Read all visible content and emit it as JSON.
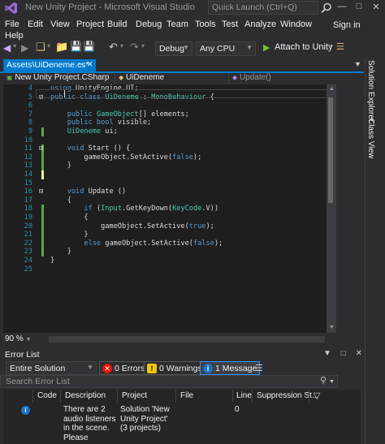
{
  "window": {
    "title": "New Unity Project - Microsoft Visual Studio",
    "quick_launch_placeholder": "Quick Launch (Ctrl+Q)",
    "sign_in": "Sign in"
  },
  "menu": [
    "File",
    "Edit",
    "View",
    "Project",
    "Build",
    "Debug",
    "Team",
    "Tools",
    "Test",
    "Analyze",
    "Window",
    "Help"
  ],
  "toolbar": {
    "configuration": "Debug",
    "platform": "Any CPU",
    "run_label": "Attach to Unity"
  },
  "tab": {
    "label": "Assets\\UiDeneme.cs*"
  },
  "navbar": {
    "project": "New Unity Project.CSharp",
    "class": "UiDeneme",
    "member": "Update()"
  },
  "editor": {
    "zoom": "90 %",
    "lines": [
      {
        "n": "4",
        "code": "using UnityEngine.UI;"
      },
      {
        "n": "5",
        "code": "public class UiDeneme : MonoBehaviour {"
      },
      {
        "n": "6",
        "code": ""
      },
      {
        "n": "7",
        "code": "    public GameObject[] elements;"
      },
      {
        "n": "8",
        "code": "    public bool visible;"
      },
      {
        "n": "9",
        "code": "    UiDeneme ui;"
      },
      {
        "n": "10",
        "code": ""
      },
      {
        "n": "11",
        "code": "    void Start () {"
      },
      {
        "n": "12",
        "code": "        gameObject.SetActive(false);"
      },
      {
        "n": "13",
        "code": "    }"
      },
      {
        "n": "14",
        "code": ""
      },
      {
        "n": "15",
        "code": ""
      },
      {
        "n": "16",
        "code": "    void Update ()"
      },
      {
        "n": "17",
        "code": "    {"
      },
      {
        "n": "18",
        "code": "        if (Input.GetKeyDown(KeyCode.V))"
      },
      {
        "n": "19",
        "code": "        {"
      },
      {
        "n": "20",
        "code": "            gameObject.SetActive(true);"
      },
      {
        "n": "21",
        "code": "        }"
      },
      {
        "n": "22",
        "code": "        else gameObject.SetActive(false);"
      },
      {
        "n": "23",
        "code": "    }"
      },
      {
        "n": "24",
        "code": "}"
      },
      {
        "n": "25",
        "code": ""
      }
    ]
  },
  "side_tabs": [
    "Solution Explorer",
    "Class View"
  ],
  "error_list": {
    "title": "Error List",
    "scope": "Entire Solution",
    "errors": "0 Errors",
    "warnings": "0 Warnings",
    "messages": "1 Message",
    "search_placeholder": "Search Error List",
    "columns": [
      "Code",
      "Description",
      "Project",
      "File",
      "Line",
      "Suppression St..."
    ],
    "rows": [
      {
        "code": "",
        "description": "There are 2 audio listeners in the scene. Please",
        "project": "Solution 'New Unity Project' (3 projects)",
        "file": "",
        "line": "0",
        "suppression": ""
      }
    ]
  },
  "colors": {
    "accent": "#007acc",
    "keyword": "#569cd6",
    "type": "#4ec9b0",
    "line_number": "#2b91af",
    "change_saved": "#57a64a",
    "change_unsaved": "#efef91"
  }
}
